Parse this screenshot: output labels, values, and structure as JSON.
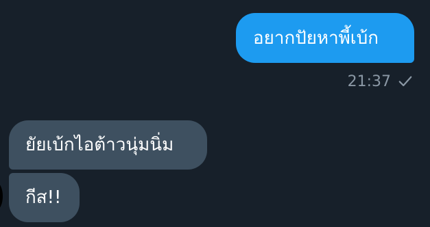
{
  "messages": {
    "sent": [
      {
        "text": "อยากปัยหาพี้เบ้ก",
        "time": "21:37",
        "status_icon": "check-icon"
      }
    ],
    "received": [
      {
        "text": "ยัยเบ้กไอต้าวนุ่มนิ่ม"
      },
      {
        "text": "กีส!!"
      }
    ]
  },
  "colors": {
    "background": "#17202a",
    "sent_bubble": "#1d9bf0",
    "received_bubble": "#3e5060",
    "meta_text": "#8b98a5"
  }
}
